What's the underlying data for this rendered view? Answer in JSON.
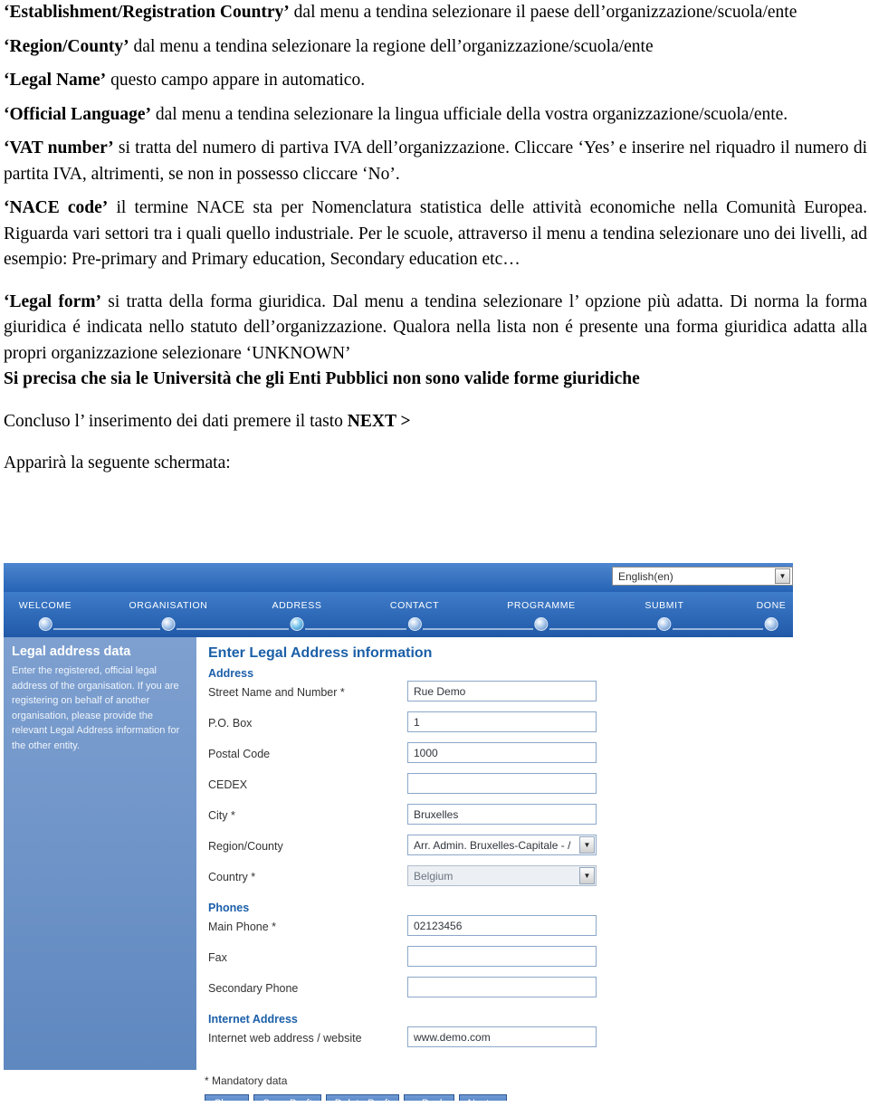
{
  "document": {
    "paragraphs": [
      {
        "id": "p-establishment",
        "runs": [
          {
            "text": "‘Establishment/Registration Country’",
            "bold": true
          },
          {
            "text": " dal menu a tendina selezionare il paese dell’organizzazione/scuola/ente",
            "bold": false
          }
        ]
      },
      {
        "id": "p-region",
        "runs": [
          {
            "text": "‘Region/County’",
            "bold": true
          },
          {
            "text": " dal menu a tendina selezionare la regione dell’organizzazione/scuola/ente",
            "bold": false
          }
        ]
      },
      {
        "id": "p-legal-name",
        "runs": [
          {
            "text": "‘Legal Name’",
            "bold": true
          },
          {
            "text": " questo campo appare in automatico.",
            "bold": false
          }
        ]
      },
      {
        "id": "p-official-language",
        "runs": [
          {
            "text": "‘Official Language’",
            "bold": true
          },
          {
            "text": " dal menu a tendina selezionare la lingua ufficiale della vostra organizzazione/scuola/ente.",
            "bold": false
          }
        ]
      },
      {
        "id": "p-vat",
        "runs": [
          {
            "text": "‘VAT number’",
            "bold": true
          },
          {
            "text": " si tratta del numero di partiva IVA dell’organizzazione. Cliccare ‘Yes’ e inserire nel riquadro il numero di partita IVA, altrimenti, se non in possesso cliccare ‘No’.",
            "bold": false
          }
        ]
      },
      {
        "id": "p-nace",
        "runs": [
          {
            "text": "‘NACE code’",
            "bold": true
          },
          {
            "text": " il termine NACE sta per Nomenclatura statistica delle attività economiche nella Comunità Europea. Riguarda vari settori tra i quali quello industriale. Per le scuole, attraverso il menu a tendina selezionare uno dei livelli, ad esempio: Pre-primary and Primary education, Secondary education etc…",
            "bold": false
          }
        ]
      },
      {
        "id": "p-legal-form",
        "runs": [
          {
            "text": "‘Legal form’",
            "bold": true
          },
          {
            "text": " si tratta della forma giuridica. Dal menu a tendina selezionare l’ opzione più adatta. Di norma la forma giuridica é indicata nello statuto dell’organizzazione. Qualora nella lista non é presente una forma giuridica adatta alla propri organizzazione selezionare ‘UNKNOWN’",
            "bold": false
          }
        ]
      },
      {
        "id": "p-precisa",
        "runs": [
          {
            "text": "Si precisa che sia le Università che gli Enti Pubblici non sono valide forme giuridiche",
            "bold": true
          }
        ]
      },
      {
        "id": "p-concluso",
        "runs": [
          {
            "text": "Concluso l’ inserimento dei dati premere il tasto ",
            "bold": false
          },
          {
            "text": "NEXT >",
            "bold": true
          }
        ]
      },
      {
        "id": "p-apparira",
        "runs": [
          {
            "text": "Apparirà la seguente schermata:",
            "bold": false
          }
        ]
      }
    ]
  },
  "screenshot": {
    "language_selector": {
      "value": "English(en)",
      "arrow_icon": "chevron-down-icon"
    },
    "steps": [
      {
        "label": "WELCOME",
        "active": false
      },
      {
        "label": "ORGANISATION",
        "active": false
      },
      {
        "label": "ADDRESS",
        "active": true
      },
      {
        "label": "CONTACT",
        "active": false
      },
      {
        "label": "PROGRAMME",
        "active": false
      },
      {
        "label": "SUBMIT",
        "active": false
      },
      {
        "label": "DONE",
        "active": false
      }
    ],
    "side_panel": {
      "title": "Legal address data",
      "description": "Enter the registered, official legal address of the organisation. If you are registering on behalf of another organisation, please provide the relevant Legal Address information for the other entity."
    },
    "form": {
      "title": "Enter Legal Address information",
      "groups": [
        {
          "heading": "Address",
          "fields": [
            {
              "label": "Street Name and Number *",
              "value": "Rue Demo",
              "type": "text",
              "disabled": false
            },
            {
              "label": "P.O. Box",
              "value": "1",
              "type": "text",
              "disabled": false
            },
            {
              "label": "Postal Code",
              "value": "1000",
              "type": "text",
              "disabled": false
            },
            {
              "label": "CEDEX",
              "value": "",
              "type": "text",
              "disabled": false
            },
            {
              "label": "City *",
              "value": "Bruxelles",
              "type": "text",
              "disabled": false
            },
            {
              "label": "Region/County",
              "value": "Arr. Admin. Bruxelles-Capitale - /",
              "type": "select",
              "disabled": false
            },
            {
              "label": "Country *",
              "value": "Belgium",
              "type": "select",
              "disabled": true
            }
          ]
        },
        {
          "heading": "Phones",
          "fields": [
            {
              "label": "Main Phone *",
              "value": "02123456",
              "type": "text",
              "disabled": false
            },
            {
              "label": "Fax",
              "value": "",
              "type": "text",
              "disabled": false
            },
            {
              "label": "Secondary Phone",
              "value": "",
              "type": "text",
              "disabled": false
            }
          ]
        },
        {
          "heading": "Internet Address",
          "fields": [
            {
              "label": "Internet web address / website",
              "value": "www.demo.com",
              "type": "text",
              "disabled": false
            }
          ]
        }
      ],
      "mandatory_note": "* Mandatory data",
      "buttons": [
        {
          "label": "Close"
        },
        {
          "label": "Save Draft"
        },
        {
          "label": "Delete Draft"
        },
        {
          "label": "< Back"
        },
        {
          "label": "Next >"
        }
      ]
    }
  }
}
